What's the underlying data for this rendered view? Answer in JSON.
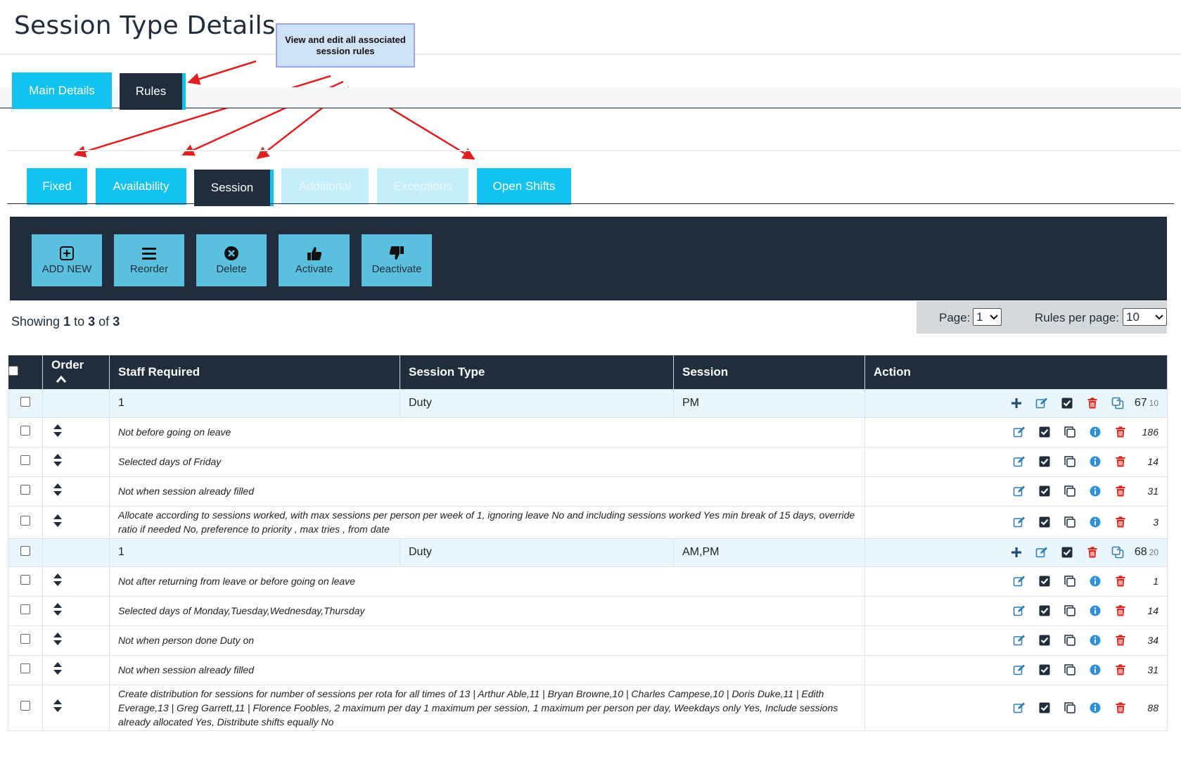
{
  "page": {
    "title": "Session Type Details",
    "callout": "View and edit all associated session rules"
  },
  "top_tabs": [
    {
      "label": "Main Details",
      "state": "inactive"
    },
    {
      "label": "Rules",
      "state": "active"
    }
  ],
  "rule_tabs": [
    {
      "label": "Fixed",
      "state": "inactive"
    },
    {
      "label": "Availability",
      "state": "inactive"
    },
    {
      "label": "Session",
      "state": "active"
    },
    {
      "label": "Additional",
      "state": "disabled"
    },
    {
      "label": "Exceptions",
      "state": "disabled"
    },
    {
      "label": "Open Shifts",
      "state": "inactive"
    }
  ],
  "toolbar": {
    "add_new": "ADD NEW",
    "reorder": "Reorder",
    "delete": "Delete",
    "activate": "Activate",
    "deactivate": "Deactivate"
  },
  "showing": {
    "prefix": "Showing",
    "from": "1",
    "to_word": "to",
    "to": "3",
    "of_word": "of",
    "total": "3"
  },
  "pager": {
    "page_label": "Page:",
    "page_value": "1",
    "per_page_label": "Rules per page:",
    "per_page_value": "10"
  },
  "table": {
    "headers": {
      "order": "Order",
      "staff_required": "Staff Required",
      "session_type": "Session Type",
      "session": "Session",
      "action": "Action"
    },
    "groups": [
      {
        "staff_required": "1",
        "session_type": "Duty",
        "session": "PM",
        "count": "67",
        "subcount": "10",
        "rules": [
          {
            "text": "Not before going on leave",
            "count": "186"
          },
          {
            "text": "Selected days of Friday",
            "count": "14"
          },
          {
            "text": "Not when session already filled",
            "count": "31"
          },
          {
            "text": "Allocate according to sessions worked, with max sessions per person per week of 1, ignoring leave No and including sessions worked Yes min break of 15 days, override ratio if needed No, preference to priority , max tries , from date",
            "count": "3"
          }
        ]
      },
      {
        "staff_required": "1",
        "session_type": "Duty",
        "session": "AM,PM",
        "count": "68",
        "subcount": "20",
        "rules": [
          {
            "text": "Not after returning from leave or before going on leave",
            "count": "1"
          },
          {
            "text": "Selected days of Monday,Tuesday,Wednesday,Thursday",
            "count": "14"
          },
          {
            "text": "Not when person done Duty on",
            "count": "34"
          },
          {
            "text": "Not when session already filled",
            "count": "31"
          },
          {
            "text": "Create distribution for sessions for number of sessions per rota for all times of 13 | Arthur Able,11 | Bryan Browne,10 | Charles Campese,10 | Doris Duke,11 | Edith Everage,13 | Greg Garrett,11 | Florence Foobles, 2 maximum per day 1 maximum per session, 1 maximum per person per day, Weekdays only Yes, Include sessions already allocated Yes, Distribute shifts equally No",
            "count": "88"
          }
        ]
      }
    ]
  },
  "colors": {
    "navy": "#1f2d3d",
    "cyan": "#12c3f2",
    "light_blue": "#5bc0de",
    "annotation_red": "#e02020",
    "delete_red": "#e2231a",
    "info_blue": "#2f8fdc"
  }
}
